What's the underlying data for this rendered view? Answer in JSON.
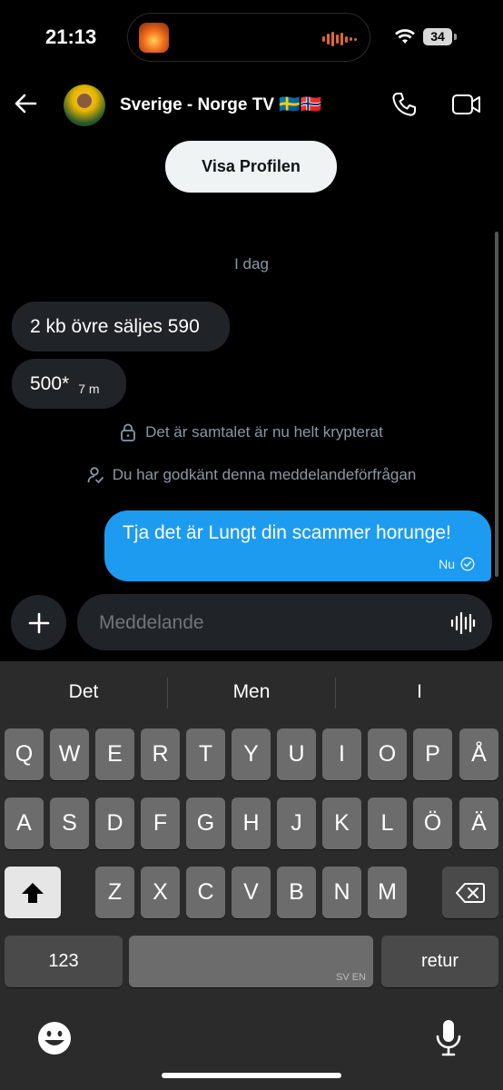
{
  "status_bar": {
    "time": "21:13",
    "battery": "34"
  },
  "header": {
    "title": "Sverige - Norge TV 🇸🇪🇳🇴"
  },
  "profile_button": {
    "label": "Visa Profilen"
  },
  "conversation": {
    "date_label": "I dag",
    "incoming": [
      {
        "text": "2 kb övre säljes 590"
      },
      {
        "text": "500*",
        "time": "7 m"
      }
    ],
    "system_messages": [
      "Det är samtalet är nu helt krypterat",
      "Du har godkänt denna meddelandeförfrågan"
    ],
    "outgoing": {
      "text": "Tja det är Lungt din scammer horunge!",
      "status": "Nu"
    }
  },
  "composer": {
    "placeholder": "Meddelande"
  },
  "keyboard": {
    "suggestions": [
      "Det",
      "Men",
      "I"
    ],
    "row1": [
      "Q",
      "W",
      "E",
      "R",
      "T",
      "Y",
      "U",
      "I",
      "O",
      "P",
      "Å"
    ],
    "row2": [
      "A",
      "S",
      "D",
      "F",
      "G",
      "H",
      "J",
      "K",
      "L",
      "Ö",
      "Ä"
    ],
    "row3": [
      "Z",
      "X",
      "C",
      "V",
      "B",
      "N",
      "M"
    ],
    "numbers_label": "123",
    "space_hint": "SV EN",
    "return_label": "retur"
  },
  "colors": {
    "accent": "#1d9bf0",
    "bubble_in": "#202327",
    "keyboard_bg": "#2b2b2b"
  }
}
